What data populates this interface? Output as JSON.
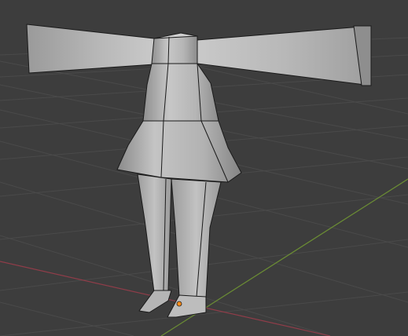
{
  "viewport": {
    "background": "#3d3d3d",
    "grid_color": "#4a4a4a",
    "x_axis_color": "#8f3d49",
    "y_axis_color": "#6b8d34",
    "mesh_fill": "#a9a9a9",
    "mesh_edge": "#1a1a1a",
    "origin_color": "#ff8c1a"
  },
  "scene": {
    "object": "low-poly-character-mesh",
    "mode": "edit-mode-wireframe",
    "origin_marker": "origin-dot"
  }
}
